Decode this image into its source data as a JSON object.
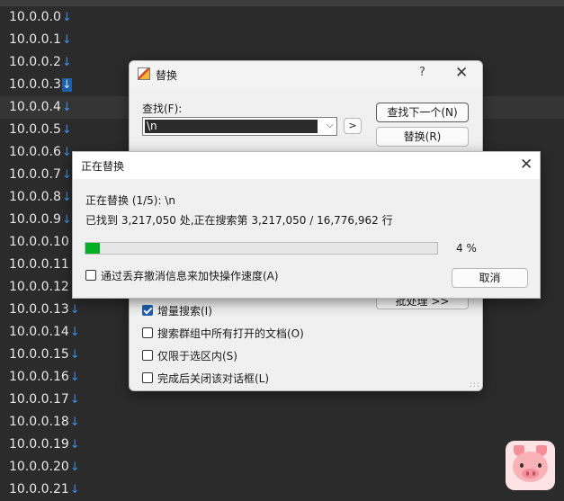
{
  "editor": {
    "lines": [
      {
        "text": "10.0.0.0",
        "eol": "↓",
        "selected": false
      },
      {
        "text": "10.0.0.1",
        "eol": "↓",
        "selected": false
      },
      {
        "text": "10.0.0.2",
        "eol": "↓",
        "selected": false
      },
      {
        "text": "10.0.0.3",
        "eol": "↓",
        "selected": true
      },
      {
        "text": "10.0.0.4",
        "eol": "↓",
        "selected": false
      },
      {
        "text": "10.0.0.5",
        "eol": "↓",
        "selected": false
      },
      {
        "text": "10.0.0.6",
        "eol": "↓",
        "selected": false
      },
      {
        "text": "10.0.0.7",
        "eol": "↓",
        "selected": false
      },
      {
        "text": "10.0.0.8",
        "eol": "↓",
        "selected": false
      },
      {
        "text": "10.0.0.9",
        "eol": "↓",
        "selected": false
      },
      {
        "text": "10.0.0.10",
        "eol": "↓",
        "selected": false
      },
      {
        "text": "10.0.0.11",
        "eol": "↓",
        "selected": false
      },
      {
        "text": "10.0.0.12",
        "eol": "↓",
        "selected": false
      },
      {
        "text": "10.0.0.13",
        "eol": "↓",
        "selected": false
      },
      {
        "text": "10.0.0.14",
        "eol": "↓",
        "selected": false
      },
      {
        "text": "10.0.0.15",
        "eol": "↓",
        "selected": false
      },
      {
        "text": "10.0.0.16",
        "eol": "↓",
        "selected": false
      },
      {
        "text": "10.0.0.17",
        "eol": "↓",
        "selected": false
      },
      {
        "text": "10.0.0.18",
        "eol": "↓",
        "selected": false
      },
      {
        "text": "10.0.0.19",
        "eol": "↓",
        "selected": false
      },
      {
        "text": "10.0.0.20",
        "eol": "↓",
        "selected": false
      },
      {
        "text": "10.0.0.21",
        "eol": "↓",
        "selected": false
      }
    ],
    "current_line_index": 4
  },
  "replace_dialog": {
    "title": "替换",
    "help_glyph": "?",
    "close_glyph": "✕",
    "find_label": "查找(F):",
    "find_value": "\\n",
    "dropdown_glyph": "⌵",
    "arrow_button_label": ">",
    "find_next_label": "查找下一个(N)",
    "replace_label": "替换(R)",
    "batch_label": "批处理 >>",
    "resize_glyph": ":::",
    "options": [
      {
        "label": "增量搜索(I)",
        "checked": true
      },
      {
        "label": "搜索群组中所有打开的文档(O)",
        "checked": false
      },
      {
        "label": "仅限于选区内(S)",
        "checked": false
      },
      {
        "label": "完成后关闭该对话框(L)",
        "checked": false
      }
    ]
  },
  "progress_dialog": {
    "title": "正在替换",
    "close_glyph": "✕",
    "status_line": "正在替换 (1/5): \\n",
    "found_line": "已找到 3,217,050 处,正在搜索第 3,217,050 / 16,776,962 行",
    "progress_percent": 4,
    "progress_text": "4 %",
    "speedup_label": "通过丢弃撤消信息来加快操作速度(A)",
    "speedup_checked": false,
    "cancel_label": "取消"
  },
  "colors": {
    "editor_bg": "#2b2b2b",
    "eol_marker": "#3d8fe3",
    "progress_fill": "#06b025",
    "checkbox_accent": "#1f5fa8"
  },
  "icons": {
    "app": "notepad-app-icon",
    "sticker": "pig-sticker"
  }
}
